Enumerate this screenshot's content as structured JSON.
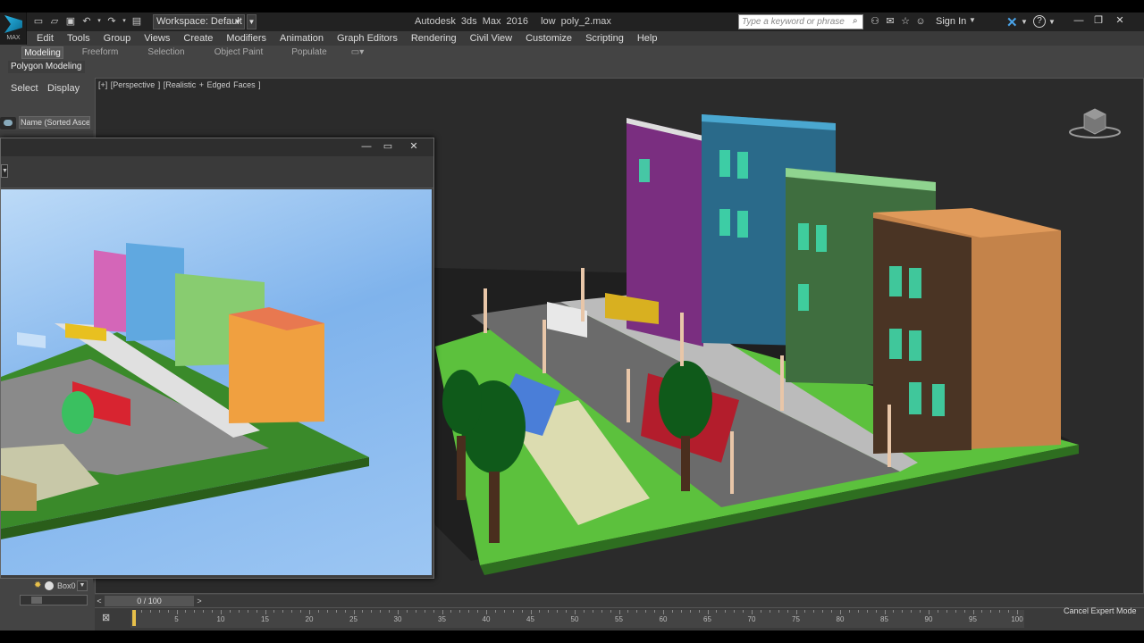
{
  "app": {
    "title": "Autodesk 3ds Max 2016",
    "file": "low poly_2.max",
    "logo_text": "MAX",
    "workspace": "Workspace: Default",
    "search_placeholder": "Type a keyword or phrase",
    "sign_in": "Sign In"
  },
  "menu": [
    "Edit",
    "Tools",
    "Group",
    "Views",
    "Create",
    "Modifiers",
    "Animation",
    "Graph Editors",
    "Rendering",
    "Civil View",
    "Customize",
    "Scripting",
    "Help"
  ],
  "ribbon": {
    "tabs": [
      "Modeling",
      "Freeform",
      "Selection",
      "Object Paint",
      "Populate"
    ],
    "active_tab": "Modeling",
    "sub_label": "Polygon Modeling"
  },
  "scene_explorer": {
    "select_label": "Select",
    "display_label": "Display",
    "column_header": "Name (Sorted Ascer",
    "object_name": "Box0"
  },
  "viewport": {
    "label": "[+] [Perspective ] [Realistic + Edged Faces ]"
  },
  "timeline": {
    "frame_readout": "0 / 100",
    "ticks": [
      "5",
      "10",
      "15",
      "20",
      "25",
      "30",
      "35",
      "40",
      "45",
      "50",
      "55",
      "60",
      "65",
      "70",
      "75",
      "80",
      "85",
      "90",
      "95",
      "100"
    ],
    "current_frame": 0,
    "total_frames": 100
  },
  "status": {
    "cancel_expert": "Cancel Expert Mode"
  },
  "colors": {
    "accent": "#29b6e8",
    "viewport_bg": "#2b2b2b",
    "ui_bg": "#444444",
    "grass": "#5cc13d",
    "render_sky": "#8ebcf0"
  }
}
